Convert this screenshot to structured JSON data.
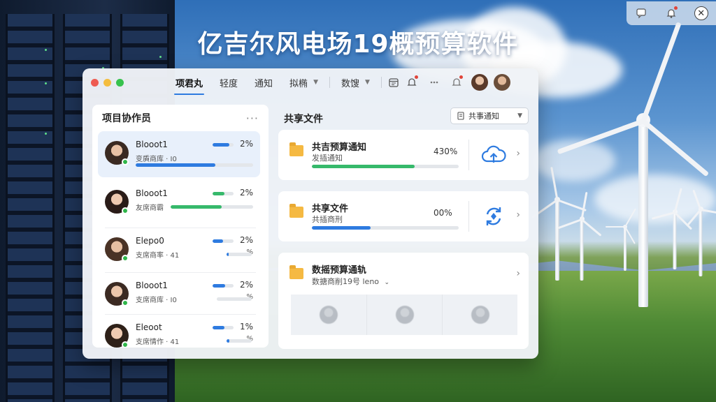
{
  "headline": "亿吉尔风电场19概预算软件",
  "system_controls": {
    "message_icon": "chat-icon",
    "notification_icon": "bell-icon",
    "close_icon": "close-icon",
    "close_glyph": "✕"
  },
  "window": {
    "traffic_colors": [
      "#ee5b52",
      "#f4bd3f",
      "#37c24d"
    ],
    "tabs": [
      {
        "label": "项君丸",
        "active": true,
        "has_caret": false
      },
      {
        "label": "轻度",
        "active": false,
        "has_caret": false
      },
      {
        "label": "通知",
        "active": false,
        "has_caret": false
      },
      {
        "label": "拟椭",
        "active": false,
        "has_caret": true
      },
      {
        "label": "数馊",
        "active": false,
        "has_caret": true
      }
    ],
    "toolbar_icons": [
      "calendar-icon",
      "notification-icon",
      "more-icon",
      "bell-icon"
    ]
  },
  "members_panel": {
    "title": "项目协作员",
    "more_glyph": "···",
    "members": [
      {
        "name": "Blooot1",
        "role": "变貭商库 · I0",
        "mini_fill": 0.8,
        "mini_color": "#2e7be0",
        "pct": "2%",
        "pct2": "",
        "main_fill": 0.68,
        "main_color": "#2e7be0",
        "selected": true
      },
      {
        "name": "Blooot1",
        "role": "友席商霸",
        "mini_fill": 0.55,
        "mini_color": "#36b96b",
        "pct": "2%",
        "pct2": "",
        "main_fill": 0.62,
        "main_color": "#36b96b",
        "selected": false
      },
      {
        "name": "Elepo0",
        "role": "支席商率 · 41",
        "mini_fill": 0.5,
        "mini_color": "#2e7be0",
        "pct": "2%",
        "pct2": "%",
        "main_fill": 0.08,
        "main_color": "#2e7be0",
        "selected": false
      },
      {
        "name": "Blooot1",
        "role": "支席商库 · I0",
        "mini_fill": 0.6,
        "mini_color": "#2e7be0",
        "pct": "2%",
        "pct2": "%",
        "main_fill": 0.0,
        "main_color": "#2e7be0",
        "selected": false
      },
      {
        "name": "Eleoot",
        "role": "支席情作 · 41",
        "mini_fill": 0.55,
        "mini_color": "#2e7be0",
        "pct": "1%",
        "pct2": "%",
        "main_fill": 0.12,
        "main_color": "#2e7be0",
        "selected": false
      }
    ]
  },
  "files_panel": {
    "title": "共享文件",
    "share_button": "共事通知",
    "cards": [
      {
        "title": "共吉预算通知",
        "subtitle": "发插通知",
        "pct": "430%",
        "fill": 0.7,
        "color": "#36b96b",
        "icon": "cloud-upload-icon"
      },
      {
        "title": "共享文件",
        "subtitle": "共插商刑",
        "pct": "00%",
        "fill": 0.4,
        "color": "#2e7be0",
        "icon": "sync-icon"
      }
    ],
    "budget_card": {
      "title": "数摇预算通轨",
      "subtitle": "数搪商削19号 leno",
      "avatars": 3
    }
  }
}
